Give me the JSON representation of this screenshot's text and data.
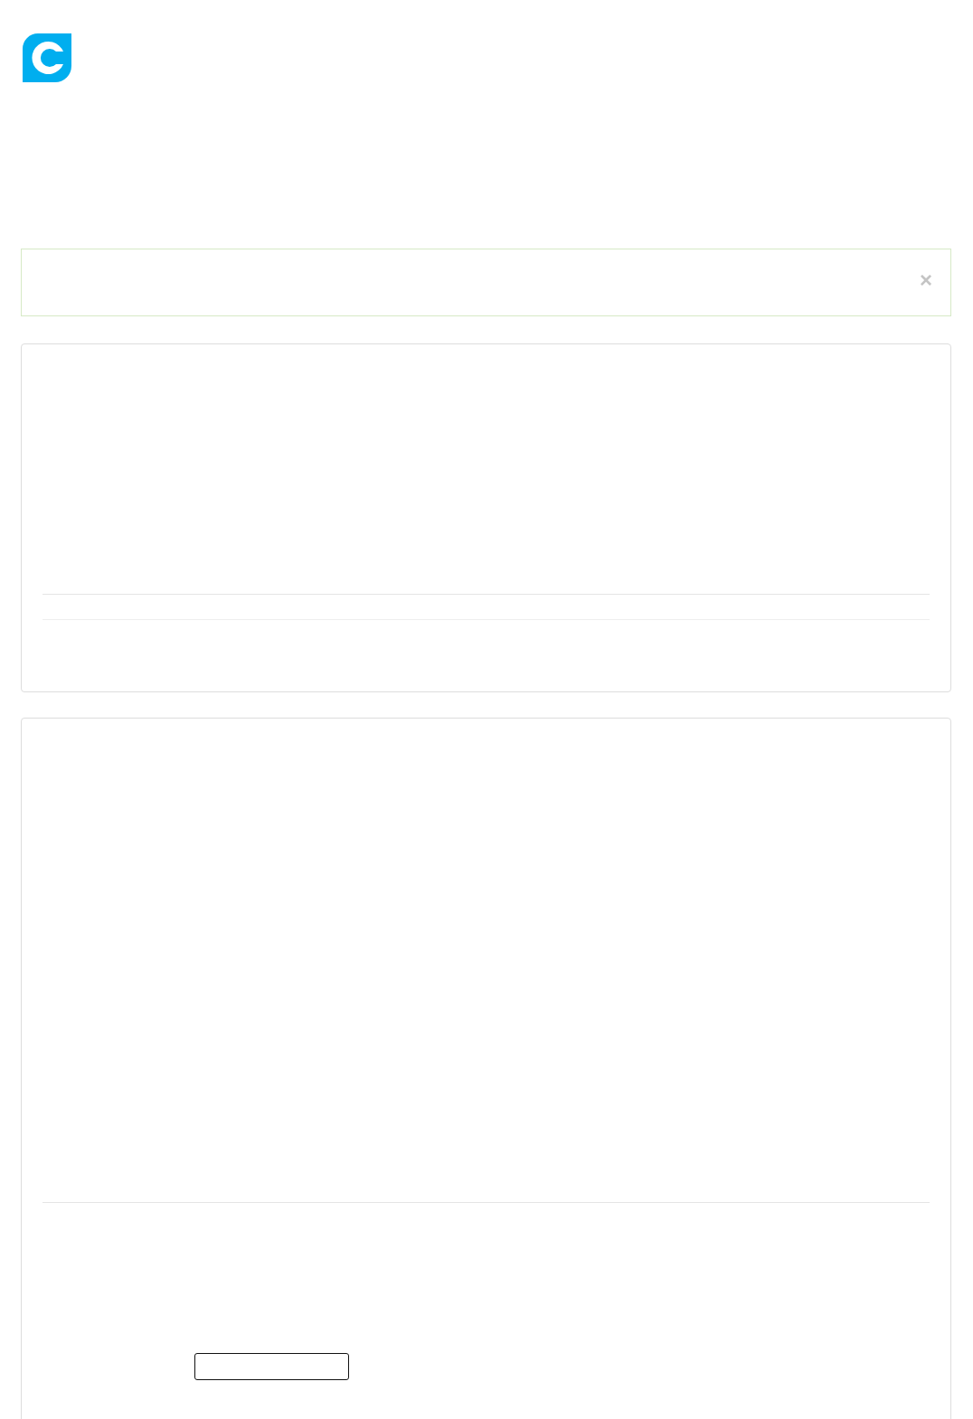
{
  "alert": {
    "close_label": "×"
  }
}
